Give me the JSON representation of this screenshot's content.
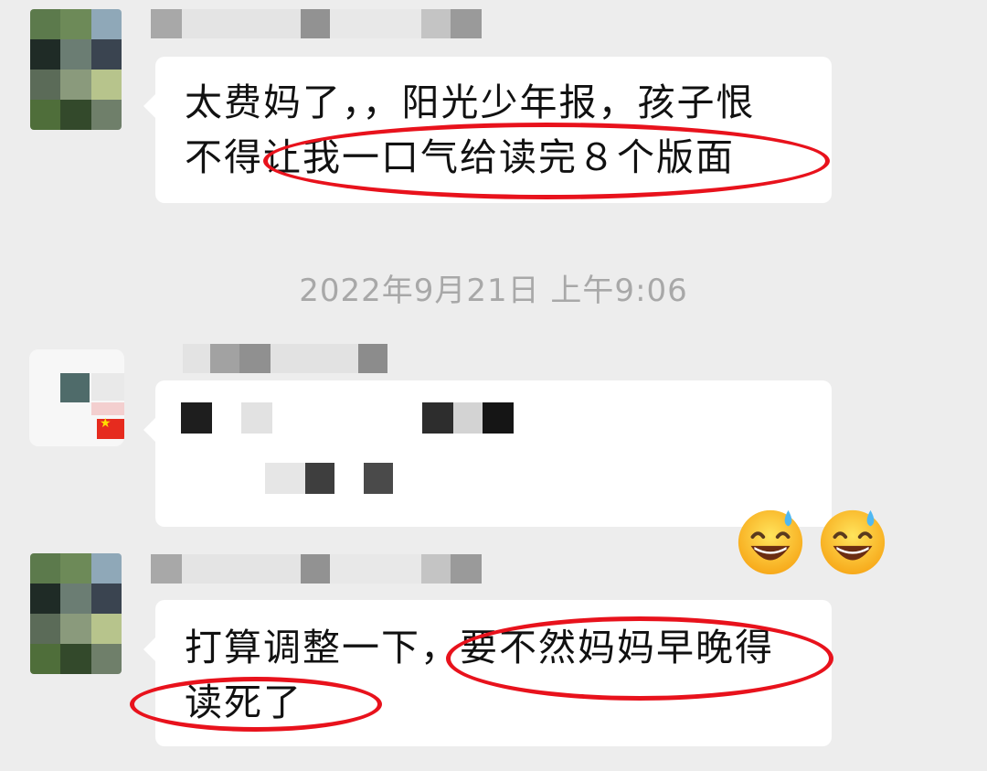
{
  "messages": [
    {
      "lines": [
        "太费妈了，，阳光少年报，孩子恨",
        "不得让我一口气给读完８个版面"
      ]
    },
    {
      "lines": []
    },
    {
      "lines": [
        "打算调整一下，要不然妈妈早晚得",
        "读死了"
      ]
    }
  ],
  "timestamp": "2022年9月21日 上午9:06",
  "reactions": [
    "grinning-sweat-emoji",
    "grinning-sweat-emoji"
  ],
  "colors": {
    "background": "#ededed",
    "bubble": "#ffffff",
    "annotation": "#e8121c",
    "timestamp": "#a8a8a8"
  }
}
